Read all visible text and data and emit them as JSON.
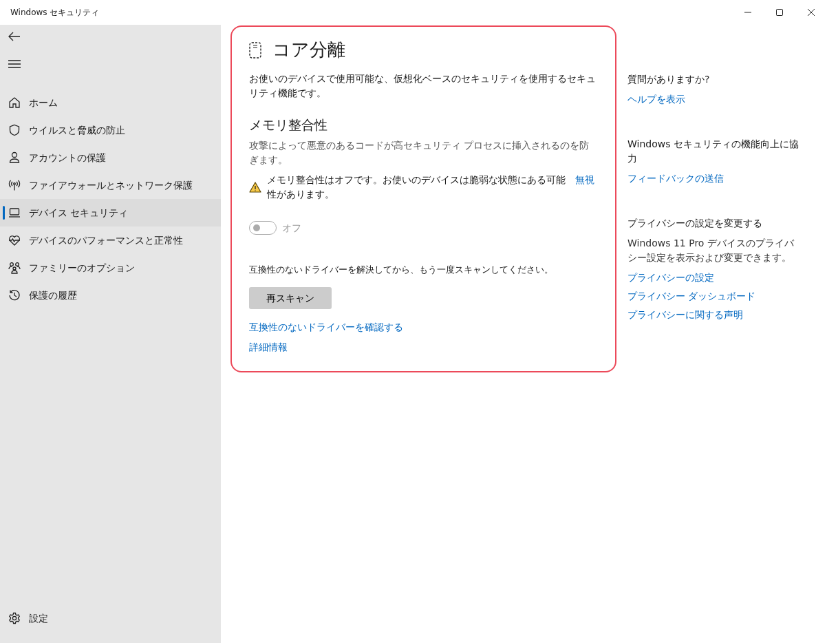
{
  "window": {
    "title": "Windows セキュリティ"
  },
  "sidebar": {
    "items": [
      {
        "label": "ホーム",
        "selected": false
      },
      {
        "label": "ウイルスと脅威の防止",
        "selected": false
      },
      {
        "label": "アカウントの保護",
        "selected": false
      },
      {
        "label": "ファイアウォールとネットワーク保護",
        "selected": false
      },
      {
        "label": "デバイス セキュリティ",
        "selected": true
      },
      {
        "label": "デバイスのパフォーマンスと正常性",
        "selected": false
      },
      {
        "label": "ファミリーのオプション",
        "selected": false
      },
      {
        "label": "保護の履歴",
        "selected": false
      }
    ],
    "settings": {
      "label": "設定"
    }
  },
  "main": {
    "title": "コア分離",
    "description": "お使いのデバイスで使用可能な、仮想化ベースのセキュリティを使用するセキュリティ機能です。",
    "section": {
      "heading": "メモリ整合性",
      "description": "攻撃によって悪意のあるコードが高セキュリティ プロセスに挿入されるのを防ぎます。",
      "warning": {
        "text": "メモリ整合性はオフです。お使いのデバイスは脆弱な状態にある可能性があります。",
        "link": "無視"
      },
      "toggle": {
        "on": false,
        "disabled": true,
        "label": "オフ"
      },
      "instruction": "互換性のないドライバーを解決してから、もう一度スキャンしてください。",
      "button": "再スキャン",
      "links": [
        "互換性のないドライバーを確認する",
        "詳細情報"
      ]
    }
  },
  "aside": [
    {
      "heading": "質問がありますか?",
      "links": [
        "ヘルプを表示"
      ]
    },
    {
      "heading": "Windows セキュリティの機能向上に協力",
      "links": [
        "フィードバックの送信"
      ]
    },
    {
      "heading": "プライバシーの設定を変更する",
      "body": "Windows 11 Pro デバイスのプライバシー設定を表示および変更できます。",
      "links": [
        "プライバシーの設定",
        "プライバシー ダッシュボード",
        "プライバシーに関する声明"
      ]
    }
  ]
}
